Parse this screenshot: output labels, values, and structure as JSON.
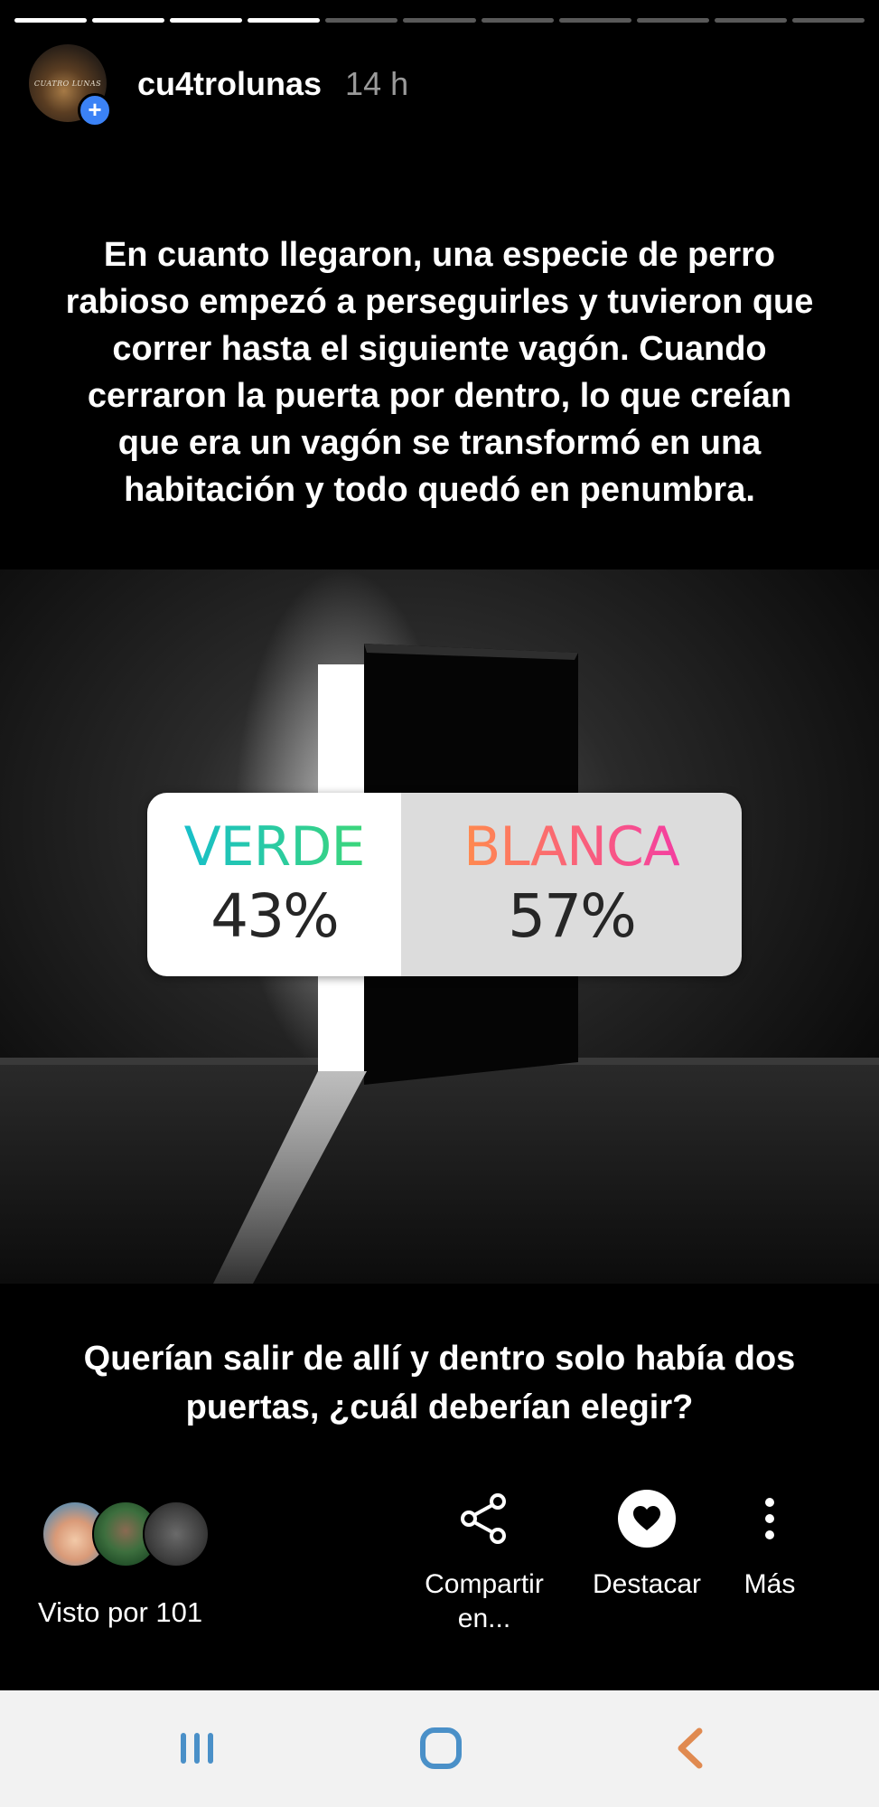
{
  "progress": {
    "segments_total": 11,
    "segments_done": 4
  },
  "header": {
    "avatar_text": "CUATRO LUNAS",
    "plus_icon": "+",
    "username": "cu4trolunas",
    "time": "14 h"
  },
  "story": {
    "text": "En cuanto llegaron, una especie de perro rabioso empezó a perseguirles y tuvieron que correr hasta el siguiente vagón. Cuando cerraron la puerta por dentro, lo que creían que era un vagón se transformó en una habitación y todo quedó en penumbra.",
    "question": "Querían salir de allí y dentro solo había dos puertas, ¿cuál deberían elegir?"
  },
  "poll": {
    "option_a": {
      "label": "VERDE",
      "percent_text": "43%",
      "fraction": 0.43
    },
    "option_b": {
      "label": "BLANCA",
      "percent_text": "57%",
      "fraction": 0.57
    }
  },
  "footer": {
    "viewers_label": "Visto por 101",
    "actions": {
      "share": {
        "label": "Compartir en...",
        "icon": "share-icon"
      },
      "highlight": {
        "label": "Destacar",
        "icon": "heart-icon"
      },
      "more": {
        "label": "Más",
        "icon": "more-vertical-icon"
      }
    }
  },
  "navbar": {
    "recent_icon": "recent-apps-icon",
    "home_icon": "home-icon",
    "back_icon": "back-icon"
  },
  "colors": {
    "verde_gradient": [
      "#18bfc9",
      "#3cd67a"
    ],
    "blanca_gradient": [
      "#ff8a4e",
      "#f43ea0"
    ],
    "plus_badge": "#3b82f6",
    "nav_recent": "#4a90c8",
    "nav_back": "#e08a50"
  }
}
